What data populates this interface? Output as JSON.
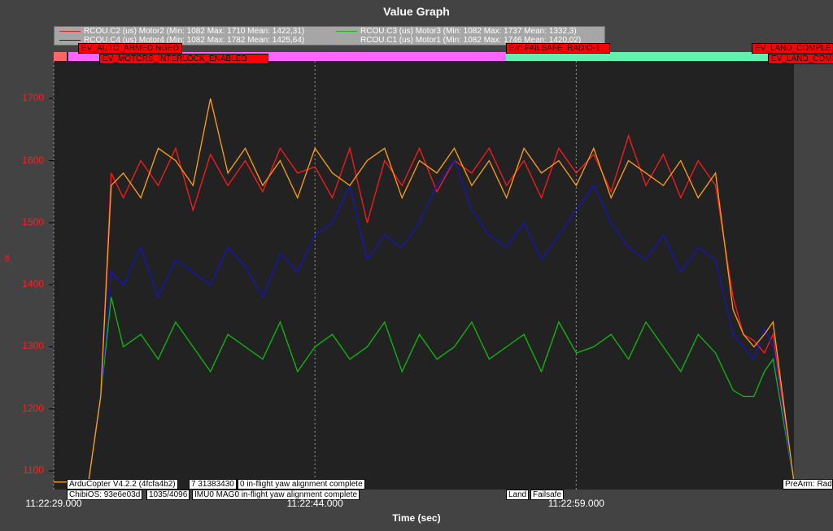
{
  "window": {
    "title": "Value Graph"
  },
  "legend": [
    {
      "label": "RCOU.C2 (us) Motor2 (Min: 1082 Max: 1710 Mean: 1422,31)",
      "color": "#ff1a1a"
    },
    {
      "label": "RCOU.C3 (us) Motor3 (Min: 1082 Max: 1737 Mean: 1332,3)",
      "color": "#0dbb0d"
    },
    {
      "label": "RCOU.C4 (us) Motor4 (Min: 1082 Max: 1782 Mean: 1425,64)",
      "color": "#1515c8"
    },
    {
      "label": "RCOU.C1 (us) Motor1 (Min: 1082 Max: 1746 Mean: 1420,02)",
      "color": "#ff9f1a"
    }
  ],
  "events": [
    {
      "text": "EV_AUTO_ARMED NGED"
    },
    {
      "text": "EV_MOTORS_INTERLOCK_ENABLED"
    },
    {
      "text": "Err: FAILSAFE_RADIO-1"
    },
    {
      "text": "EV_LAND_COMPLE"
    },
    {
      "text": "EV_LAND_COMP"
    }
  ],
  "messages": [
    {
      "text": "ArduCopter V4.2.2 (4fcfa4b2)"
    },
    {
      "text": "7 31383430"
    },
    {
      "text": "0 in-flight yaw alignment complete"
    },
    {
      "text": "ChibiOS: 93e6e03d"
    },
    {
      "text": "1035/4096"
    },
    {
      "text": "IMU0 MAG0 in-flight yaw alignment complete"
    },
    {
      "text": "Land"
    },
    {
      "text": "Failsafe"
    },
    {
      "text": "PreArm: Rad"
    }
  ],
  "colors": {
    "plot_bg": "#222222",
    "frame_bg": "#434343",
    "mode_stabilize": "#ff66ff",
    "mode_land": "#66f0b0",
    "mode_pre": "#ff6666"
  },
  "chart_data": {
    "type": "line",
    "title": "Value Graph",
    "xlabel": "Time (sec)",
    "ylabel": "us",
    "xlim": [
      29.0,
      71.5
    ],
    "ylim": [
      1070,
      1775
    ],
    "x_ticks": [
      {
        "t": 29.0,
        "label": "11:22:29.000"
      },
      {
        "t": 44.0,
        "label": "11:22:44.000"
      },
      {
        "t": 59.0,
        "label": "11:22:59.000"
      }
    ],
    "y_ticks": [
      1100,
      1200,
      1300,
      1400,
      1500,
      1600,
      1700
    ],
    "grid": true,
    "legend_position": "top-left",
    "summary": {
      "Motor2": {
        "min": 1082,
        "max": 1710,
        "mean": 1422.31
      },
      "Motor3": {
        "min": 1082,
        "max": 1737,
        "mean": 1332.3
      },
      "Motor4": {
        "min": 1082,
        "max": 1782,
        "mean": 1425.64
      },
      "Motor1": {
        "min": 1082,
        "max": 1746,
        "mean": 1420.02
      }
    },
    "series": [
      {
        "name": "RCOU.C2 (us) Motor2",
        "color": "#ff1a1a",
        "x": [
          29.0,
          31.0,
          31.7,
          32.3,
          33.0,
          34.0,
          35.0,
          36.0,
          37.0,
          38.0,
          39.0,
          40.0,
          41.0,
          42.0,
          43.0,
          44.0,
          45.0,
          46.0,
          47.0,
          48.0,
          49.0,
          50.0,
          51.0,
          52.0,
          53.0,
          54.0,
          55.0,
          56.0,
          57.0,
          58.0,
          59.0,
          60.0,
          61.0,
          62.0,
          63.0,
          64.0,
          65.0,
          66.0,
          67.0,
          68.0,
          68.6,
          69.2,
          69.8,
          70.3,
          71.5
        ],
        "y": [
          1082,
          1082,
          1220,
          1580,
          1540,
          1600,
          1560,
          1620,
          1520,
          1610,
          1560,
          1600,
          1550,
          1620,
          1580,
          1590,
          1540,
          1620,
          1500,
          1600,
          1560,
          1620,
          1550,
          1600,
          1580,
          1620,
          1560,
          1600,
          1540,
          1620,
          1580,
          1610,
          1550,
          1640,
          1560,
          1610,
          1540,
          1600,
          1560,
          1380,
          1320,
          1310,
          1290,
          1320,
          1082
        ]
      },
      {
        "name": "RCOU.C3 (us) Motor3",
        "color": "#0dbb0d",
        "x": [
          29.0,
          31.0,
          31.7,
          32.3,
          33.0,
          34.0,
          35.0,
          36.0,
          37.0,
          38.0,
          39.0,
          40.0,
          41.0,
          42.0,
          43.0,
          44.0,
          45.0,
          46.0,
          47.0,
          48.0,
          49.0,
          50.0,
          51.0,
          52.0,
          53.0,
          54.0,
          55.0,
          56.0,
          57.0,
          58.0,
          59.0,
          60.0,
          61.0,
          62.0,
          63.0,
          64.0,
          65.0,
          66.0,
          67.0,
          68.0,
          68.6,
          69.2,
          69.8,
          70.3,
          71.5
        ],
        "y": [
          1082,
          1082,
          1220,
          1380,
          1300,
          1320,
          1280,
          1340,
          1300,
          1260,
          1320,
          1300,
          1280,
          1340,
          1260,
          1300,
          1320,
          1280,
          1300,
          1340,
          1260,
          1320,
          1280,
          1300,
          1340,
          1280,
          1300,
          1320,
          1260,
          1340,
          1290,
          1300,
          1320,
          1280,
          1340,
          1300,
          1260,
          1320,
          1290,
          1230,
          1220,
          1220,
          1260,
          1280,
          1082
        ]
      },
      {
        "name": "RCOU.C4 (us) Motor4",
        "color": "#1515c8",
        "x": [
          29.0,
          31.0,
          31.7,
          32.3,
          33.0,
          34.0,
          35.0,
          36.0,
          37.0,
          38.0,
          39.0,
          40.0,
          41.0,
          42.0,
          43.0,
          44.0,
          45.0,
          46.0,
          47.0,
          48.0,
          49.0,
          50.0,
          51.0,
          52.0,
          53.0,
          54.0,
          55.0,
          56.0,
          57.0,
          58.0,
          59.0,
          60.0,
          61.0,
          62.0,
          63.0,
          64.0,
          65.0,
          66.0,
          67.0,
          68.0,
          68.6,
          69.2,
          69.8,
          70.3,
          71.5
        ],
        "y": [
          1082,
          1082,
          1220,
          1420,
          1400,
          1460,
          1380,
          1440,
          1420,
          1400,
          1460,
          1430,
          1380,
          1450,
          1420,
          1480,
          1500,
          1560,
          1440,
          1480,
          1460,
          1500,
          1560,
          1600,
          1520,
          1480,
          1460,
          1500,
          1440,
          1480,
          1520,
          1560,
          1500,
          1460,
          1440,
          1480,
          1420,
          1460,
          1440,
          1320,
          1300,
          1280,
          1330,
          1300,
          1082
        ]
      },
      {
        "name": "RCOU.C1 (us) Motor1",
        "color": "#ff9f1a",
        "x": [
          29.0,
          31.0,
          31.7,
          32.3,
          33.0,
          34.0,
          35.0,
          36.0,
          37.0,
          38.0,
          39.0,
          40.0,
          41.0,
          42.0,
          43.0,
          44.0,
          45.0,
          46.0,
          47.0,
          48.0,
          49.0,
          50.0,
          51.0,
          52.0,
          53.0,
          54.0,
          55.0,
          56.0,
          57.0,
          58.0,
          59.0,
          60.0,
          61.0,
          62.0,
          63.0,
          64.0,
          65.0,
          66.0,
          67.0,
          68.0,
          68.6,
          69.2,
          69.8,
          70.3,
          71.5
        ],
        "y": [
          1082,
          1082,
          1220,
          1560,
          1580,
          1540,
          1620,
          1600,
          1560,
          1700,
          1580,
          1620,
          1560,
          1600,
          1540,
          1620,
          1580,
          1560,
          1600,
          1620,
          1540,
          1600,
          1580,
          1620,
          1560,
          1600,
          1540,
          1620,
          1580,
          1600,
          1560,
          1620,
          1540,
          1600,
          1580,
          1560,
          1600,
          1540,
          1580,
          1360,
          1320,
          1300,
          1320,
          1340,
          1082
        ]
      }
    ]
  }
}
